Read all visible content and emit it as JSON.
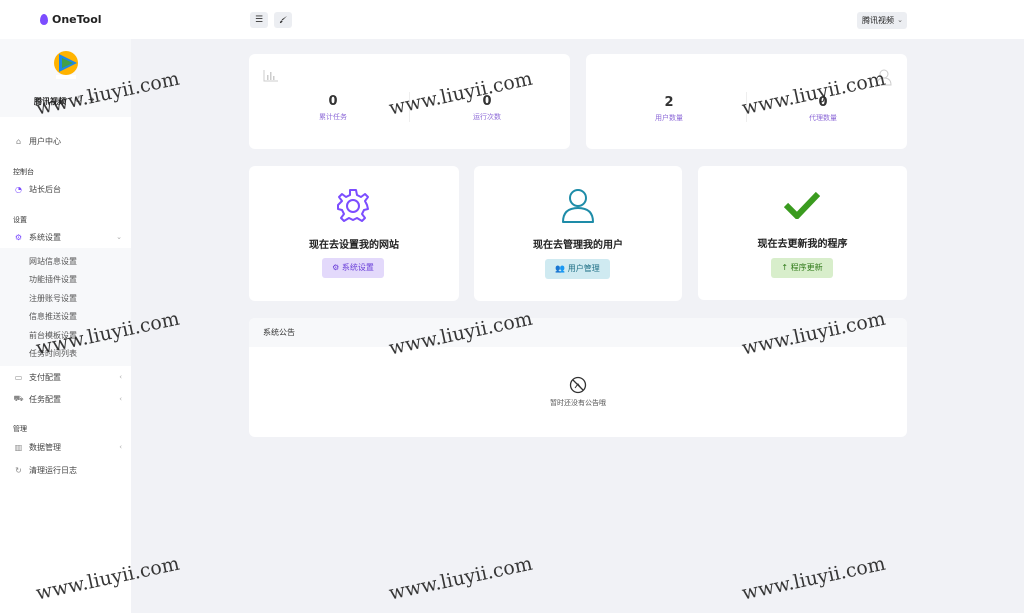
{
  "app": {
    "logo_text": "OneTool"
  },
  "topbar": {
    "menu_icon": "hamburger-icon",
    "brush_icon": "brush-icon",
    "site_select": "腾讯视频"
  },
  "profile": {
    "avatar_text": "腾讯视频",
    "name": "腾讯视频"
  },
  "sidebar": {
    "user_center": "用户中心",
    "console_head": "控制台",
    "webmaster": "站长后台",
    "settings_head": "设置",
    "system_settings": "系统设置",
    "sub_items": [
      "网站信息设置",
      "功能插件设置",
      "注册账号设置",
      "信息推送设置",
      "前台模板设置",
      "任务时间列表"
    ],
    "payment": "支付配置",
    "task_config": "任务配置",
    "manage_head": "管理",
    "data_manage": "数据管理",
    "clear_logs": "清理运行日志"
  },
  "stats_left": [
    {
      "value": "0",
      "label": "累计任务"
    },
    {
      "value": "0",
      "label": "运行次数"
    }
  ],
  "stats_right": [
    {
      "value": "2",
      "label": "用户数量"
    },
    {
      "value": "0",
      "label": "代理数量"
    }
  ],
  "actions": [
    {
      "title": "现在去设置我的网站",
      "button": "系统设置",
      "color": "#7c4dff"
    },
    {
      "title": "现在去管理我的用户",
      "button": "用户管理",
      "color": "#1e8ca8"
    },
    {
      "title": "现在去更新我的程序",
      "button": "程序更新",
      "color": "#3a9b1f"
    }
  ],
  "notice": {
    "title": "系统公告",
    "empty": "暂时还没有公告哦"
  },
  "watermark": "www.liuyii.com"
}
